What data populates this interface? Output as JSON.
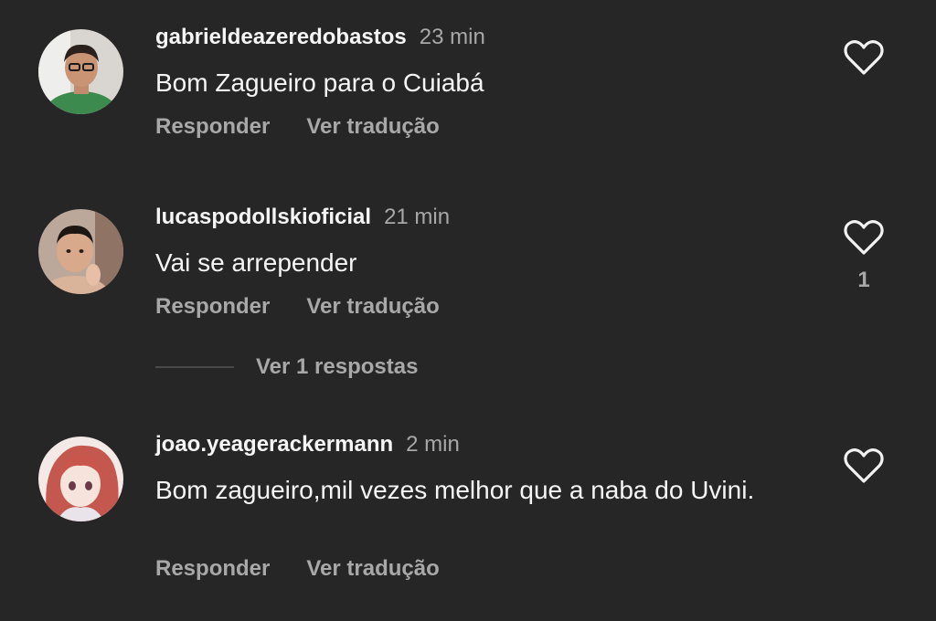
{
  "comments": [
    {
      "username": "gabrieldeazeredobastos",
      "time": "23 min",
      "text": "Bom Zagueiro para o Cuiabá",
      "reply_label": "Responder",
      "translate_label": "Ver tradução",
      "like_icon": "heart-outline-icon",
      "like_count": ""
    },
    {
      "username": "lucaspodollskioficial",
      "time": "21 min",
      "text": "Vai se arrepender",
      "reply_label": "Responder",
      "translate_label": "Ver tradução",
      "like_icon": "heart-outline-icon",
      "like_count": "1",
      "view_replies_label": "Ver 1 respostas"
    },
    {
      "username": "joao.yeagerackermann",
      "time": "2 min",
      "text": "Bom zagueiro,mil vezes melhor que a naba do Uvini.",
      "reply_label": "Responder",
      "translate_label": "Ver tradução",
      "like_icon": "heart-outline-icon",
      "like_count": ""
    }
  ],
  "colors": {
    "background": "#262626",
    "primary_text": "#f5f5f5",
    "secondary_text": "#a8a8a8"
  }
}
